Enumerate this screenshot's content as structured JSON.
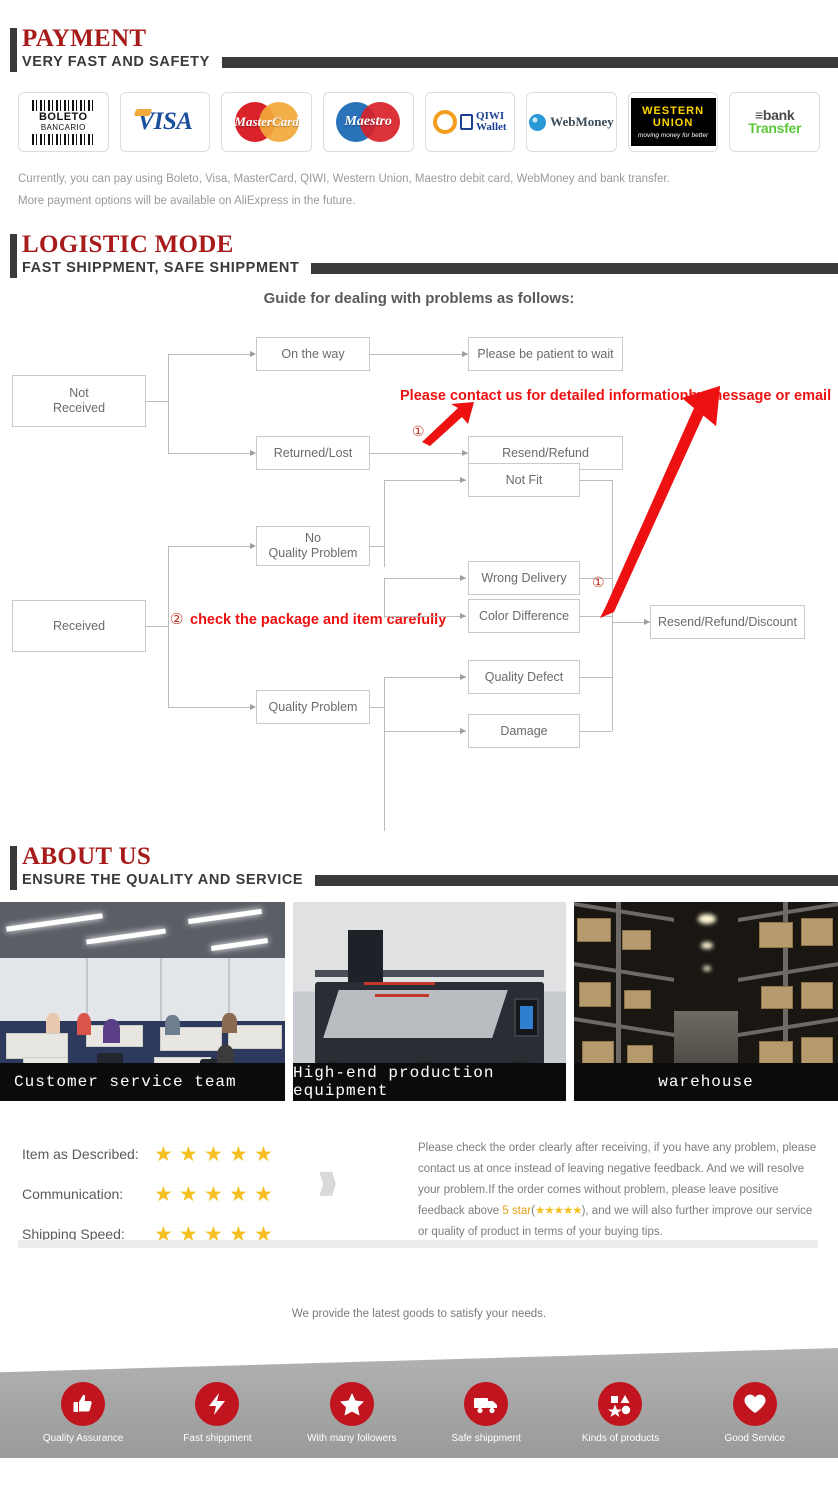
{
  "payment": {
    "title": "PAYMENT",
    "subtitle": "VERY FAST AND SAFETY",
    "methods": [
      {
        "name": "boleto-bancario",
        "line1": "BOLETO",
        "line2": "BANCARIO"
      },
      {
        "name": "visa",
        "label": "VISA"
      },
      {
        "name": "mastercard",
        "label": "MasterCard"
      },
      {
        "name": "maestro",
        "label": "Maestro"
      },
      {
        "name": "qiwi-wallet",
        "line1": "QIWI",
        "line2": "Wallet"
      },
      {
        "name": "webmoney",
        "label": "WebMoney"
      },
      {
        "name": "western-union",
        "line1": "WESTERN",
        "line2": "UNION",
        "line3": "moving money for better"
      },
      {
        "name": "bank-transfer",
        "line1": "bank",
        "line2": "Transfer"
      }
    ],
    "note_line1": "Currently, you can pay using Boleto, Visa, MasterCard, QIWI, Western Union, Maestro debit card, WebMoney and bank transfer.",
    "note_line2": "More payment options will be available on AliExpress in the future."
  },
  "logistic": {
    "title": "LOGISTIC MODE",
    "subtitle": "FAST SHIPPMENT, SAFE SHIPPMENT",
    "flow_title": "Guide for dealing with problems as follows:",
    "nodes": {
      "not_received": "Not\nReceived",
      "on_the_way": "On the way",
      "returned_lost": "Returned/Lost",
      "please_wait": "Please be patient to wait",
      "resend_refund": "Resend/Refund",
      "received": "Received",
      "no_quality_problem": "No\nQuality Problem",
      "quality_problem": "Quality Problem",
      "not_fit": "Not Fit",
      "wrong_delivery": "Wrong Delivery",
      "color_difference": "Color Difference",
      "quality_defect": "Quality Defect",
      "damage": "Damage",
      "resend_refund_discount": "Resend/Refund/Discount"
    },
    "annotation_1": "Please contact us for detailed informationby message or email",
    "annotation_2": "check the package and item carefully",
    "marker_1": "①",
    "marker_2": "②"
  },
  "about": {
    "title": "ABOUT US",
    "subtitle": "ENSURE THE QUALITY AND SERVICE",
    "photos": [
      {
        "name": "customer-service-team",
        "caption": "Customer service team"
      },
      {
        "name": "production-equipment",
        "caption": "High-end production equipment"
      },
      {
        "name": "warehouse",
        "caption": "warehouse"
      }
    ]
  },
  "ratings": {
    "rows": [
      {
        "label": "Item as Described:",
        "stars": 5
      },
      {
        "label": "Communication:",
        "stars": 5
      },
      {
        "label": "Shipping Speed:",
        "stars": 5
      }
    ],
    "star_glyph": "★",
    "feedback": {
      "part1": "Please check the order clearly after receiving, if you have any problem, please contact us at once instead of leaving negative feedback. And we will resolve your problem.If the order comes without problem, please leave positive feedback above ",
      "highlight": "5 star",
      "open_paren": "(",
      "ministars": "★★★★★",
      "close_paren": ")",
      "part2": ", and we will also further improve our service or quality of product in terms of your buying tips."
    }
  },
  "bottom": {
    "tagline": "We provide the latest goods to satisfy your needs.",
    "services": [
      {
        "icon": "thumbs-up-icon",
        "label": "Quality Assurance"
      },
      {
        "icon": "lightning-bolt-icon",
        "label": "Fast shippment"
      },
      {
        "icon": "star-icon",
        "label": "With many followers"
      },
      {
        "icon": "truck-icon",
        "label": "Safe shippment"
      },
      {
        "icon": "shapes-icon",
        "label": "Kinds of products"
      },
      {
        "icon": "heart-icon",
        "label": "Good Service"
      }
    ]
  },
  "colors": {
    "heading_red": "#a81b1b",
    "rule_dark": "#3a3a3a",
    "accent_red": "#c0141e",
    "star_gold": "#f6c022",
    "annotation_red": "#ee1111"
  }
}
